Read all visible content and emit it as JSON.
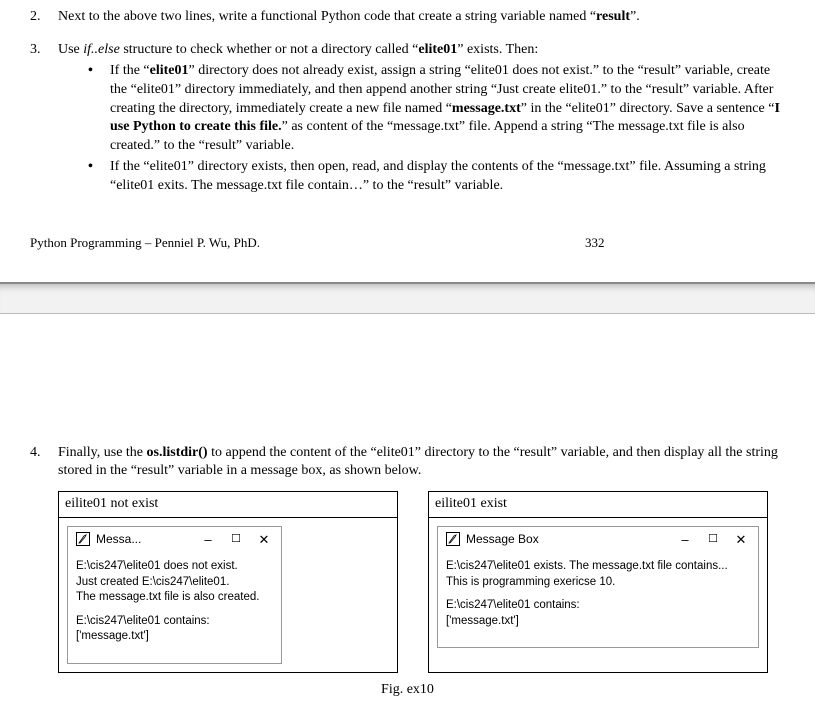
{
  "q2": {
    "num": "2.",
    "text_a": "Next to the above two lines, write a functional Python code that create a string variable named “",
    "text_b": "result",
    "text_c": "”."
  },
  "q3": {
    "num": "3.",
    "intro_a": "Use ",
    "intro_b": "if..else",
    "intro_c": " structure to check whether or not a directory called “",
    "intro_d": "elite01",
    "intro_e": "” exists. Then:",
    "b1": {
      "t1": "If the “",
      "t2": "elite01",
      "t3": "” directory does not already exist, assign a string “elite01 does not exist.” to the “result” variable, create the “elite01” directory immediately, and then append another string “Just create elite01.” to the “result” variable. After creating the directory, immediately create a new file named “",
      "t4": "message.txt",
      "t5": "” in the “elite01” directory. Save a sentence “",
      "t6": "I use Python to create this file.",
      "t7": "” as content of the “message.txt” file. Append a string “The message.txt file is also created.” to the “result” variable."
    },
    "b2": {
      "t1": "If the “elite01” directory exists, then open, read, and display the contents of the “message.txt” file. Assuming a string “elite01 exits. The message.txt file contain…” to the “result” variable."
    }
  },
  "footer": {
    "author": "Python Programming – Penniel P. Wu, PhD.",
    "page": "332"
  },
  "q4": {
    "num": "4.",
    "t1": "Finally, use the ",
    "t2": "os.listdir()",
    "t3": " to append the content of the “elite01” directory to the “result” variable, and then display all the string stored in the “result” variable in a message box, as shown below."
  },
  "leftTbl": {
    "head": "eilite01 not exist",
    "win": {
      "title": "Messa...",
      "min": "–",
      "max": "☐",
      "close": "✕"
    },
    "body": {
      "l1": "E:\\cis247\\elite01 does not exist.",
      "l2": "Just created E:\\cis247\\elite01.",
      "l3": "The message.txt file is also created.",
      "l4": "E:\\cis247\\elite01 contains:",
      "l5": "['message.txt']"
    }
  },
  "rightTbl": {
    "head": "eilite01 exist",
    "win": {
      "title": "Message Box",
      "min": "–",
      "max": "☐",
      "close": "✕"
    },
    "body": {
      "l1": "E:\\cis247\\elite01 exists. The message.txt file contains...",
      "l2": "This is programming exericse 10.",
      "l3": "E:\\cis247\\elite01 contains:",
      "l4": "['message.txt']"
    }
  },
  "fig": "Fig. ex10"
}
